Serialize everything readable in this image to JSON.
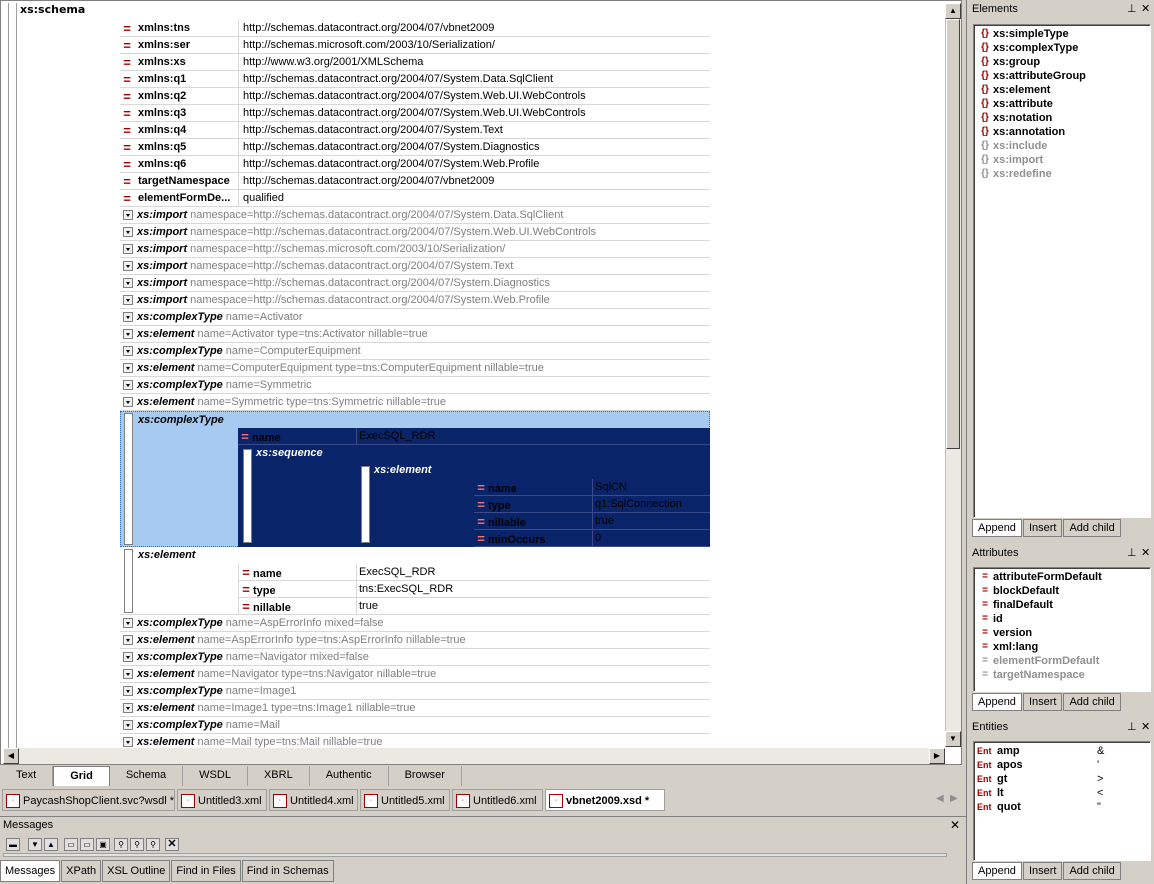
{
  "grid": {
    "root_label": "xs:schema",
    "attrs": [
      {
        "name": "xmlns:tns",
        "value": "http://schemas.datacontract.org/2004/07/vbnet2009"
      },
      {
        "name": "xmlns:ser",
        "value": "http://schemas.microsoft.com/2003/10/Serialization/"
      },
      {
        "name": "xmlns:xs",
        "value": "http://www.w3.org/2001/XMLSchema"
      },
      {
        "name": "xmlns:q1",
        "value": "http://schemas.datacontract.org/2004/07/System.Data.SqlClient"
      },
      {
        "name": "xmlns:q2",
        "value": "http://schemas.datacontract.org/2004/07/System.Web.UI.WebControls"
      },
      {
        "name": "xmlns:q3",
        "value": "http://schemas.datacontract.org/2004/07/System.Web.UI.WebControls"
      },
      {
        "name": "xmlns:q4",
        "value": "http://schemas.datacontract.org/2004/07/System.Text"
      },
      {
        "name": "xmlns:q5",
        "value": "http://schemas.datacontract.org/2004/07/System.Diagnostics"
      },
      {
        "name": "xmlns:q6",
        "value": "http://schemas.datacontract.org/2004/07/System.Web.Profile"
      },
      {
        "name": "targetNamespace",
        "value": "http://schemas.datacontract.org/2004/07/vbnet2009"
      },
      {
        "name": "elementFormDe...",
        "value": "qualified"
      }
    ],
    "elements_top": [
      {
        "name": "xs:import",
        "summary": "namespace=http://schemas.datacontract.org/2004/07/System.Data.SqlClient"
      },
      {
        "name": "xs:import",
        "summary": "namespace=http://schemas.datacontract.org/2004/07/System.Web.UI.WebControls"
      },
      {
        "name": "xs:import",
        "summary": "namespace=http://schemas.microsoft.com/2003/10/Serialization/"
      },
      {
        "name": "xs:import",
        "summary": "namespace=http://schemas.datacontract.org/2004/07/System.Text"
      },
      {
        "name": "xs:import",
        "summary": "namespace=http://schemas.datacontract.org/2004/07/System.Diagnostics"
      },
      {
        "name": "xs:import",
        "summary": "namespace=http://schemas.datacontract.org/2004/07/System.Web.Profile"
      },
      {
        "name": "xs:complexType",
        "summary": "name=Activator"
      },
      {
        "name": "xs:element",
        "summary": "name=Activator type=tns:Activator nillable=true"
      },
      {
        "name": "xs:complexType",
        "summary": "name=ComputerEquipment"
      },
      {
        "name": "xs:element",
        "summary": "name=ComputerEquipment type=tns:ComputerEquipment nillable=true"
      },
      {
        "name": "xs:complexType",
        "summary": "name=Symmetric"
      },
      {
        "name": "xs:element",
        "summary": "name=Symmetric type=tns:Symmetric nillable=true"
      }
    ],
    "selected": {
      "label": "xs:complexType",
      "name_attr": "name",
      "name_value": "ExecSQL_RDR",
      "sequence_label": "xs:sequence",
      "element_label": "xs:element",
      "attrs": [
        {
          "name": "name",
          "value": "SqlCN"
        },
        {
          "name": "type",
          "value": "q1:SqlConnection"
        },
        {
          "name": "nillable",
          "value": "true"
        },
        {
          "name": "minOccurs",
          "value": "0"
        }
      ]
    },
    "element_block": {
      "label": "xs:element",
      "attrs": [
        {
          "name": "name",
          "value": "ExecSQL_RDR"
        },
        {
          "name": "type",
          "value": "tns:ExecSQL_RDR"
        },
        {
          "name": "nillable",
          "value": "true"
        }
      ]
    },
    "elements_bottom": [
      {
        "name": "xs:complexType",
        "summary": "name=AspErrorInfo mixed=false"
      },
      {
        "name": "xs:element",
        "summary": "name=AspErrorInfo type=tns:AspErrorInfo nillable=true"
      },
      {
        "name": "xs:complexType",
        "summary": "name=Navigator mixed=false"
      },
      {
        "name": "xs:element",
        "summary": "name=Navigator type=tns:Navigator nillable=true"
      },
      {
        "name": "xs:complexType",
        "summary": "name=Image1"
      },
      {
        "name": "xs:element",
        "summary": "name=Image1 type=tns:Image1 nillable=true"
      },
      {
        "name": "xs:complexType",
        "summary": "name=Mail"
      },
      {
        "name": "xs:element",
        "summary": "name=Mail type=tns:Mail nillable=true"
      }
    ]
  },
  "view_tabs": [
    "Text",
    "Grid",
    "Schema",
    "WSDL",
    "XBRL",
    "Authentic",
    "Browser"
  ],
  "active_view": "Grid",
  "doc_tabs": [
    "PaycashShopClient.svc?wsdl *",
    "Untitled3.xml",
    "Untitled4.xml",
    "Untitled5.xml",
    "Untitled6.xml",
    "vbnet2009.xsd *"
  ],
  "messages": {
    "title": "Messages",
    "close": "✕"
  },
  "bottom_tabs": [
    "Messages",
    "XPath",
    "XSL Outline",
    "Find in Files",
    "Find in Schemas"
  ],
  "elements_panel": {
    "title": "Elements",
    "items": [
      {
        "label": "xs:simpleType",
        "enabled": true
      },
      {
        "label": "xs:complexType",
        "enabled": true
      },
      {
        "label": "xs:group",
        "enabled": true
      },
      {
        "label": "xs:attributeGroup",
        "enabled": true
      },
      {
        "label": "xs:element",
        "enabled": true
      },
      {
        "label": "xs:attribute",
        "enabled": true
      },
      {
        "label": "xs:notation",
        "enabled": true
      },
      {
        "label": "xs:annotation",
        "enabled": true
      },
      {
        "label": "xs:include",
        "enabled": false
      },
      {
        "label": "xs:import",
        "enabled": false
      },
      {
        "label": "xs:redefine",
        "enabled": false
      }
    ],
    "buttons": [
      "Append",
      "Insert",
      "Add child"
    ]
  },
  "attributes_panel": {
    "title": "Attributes",
    "items": [
      {
        "label": "attributeFormDefault",
        "enabled": true
      },
      {
        "label": "blockDefault",
        "enabled": true
      },
      {
        "label": "finalDefault",
        "enabled": true
      },
      {
        "label": "id",
        "enabled": true
      },
      {
        "label": "version",
        "enabled": true
      },
      {
        "label": "xml:lang",
        "enabled": true
      },
      {
        "label": "elementFormDefault",
        "enabled": false
      },
      {
        "label": "targetNamespace",
        "enabled": false
      }
    ],
    "buttons": [
      "Append",
      "Insert",
      "Add child"
    ]
  },
  "entities_panel": {
    "title": "Entities",
    "items": [
      {
        "name": "amp",
        "value": "&"
      },
      {
        "name": "apos",
        "value": "'"
      },
      {
        "name": "gt",
        "value": ">"
      },
      {
        "name": "lt",
        "value": "<"
      },
      {
        "name": "quot",
        "value": "\""
      }
    ],
    "buttons": [
      "Append",
      "Insert",
      "Add child"
    ]
  },
  "icons": {
    "eq": "=",
    "ent": "Ent",
    "brace": "{}",
    "pin": "⊥",
    "close": "✕"
  }
}
